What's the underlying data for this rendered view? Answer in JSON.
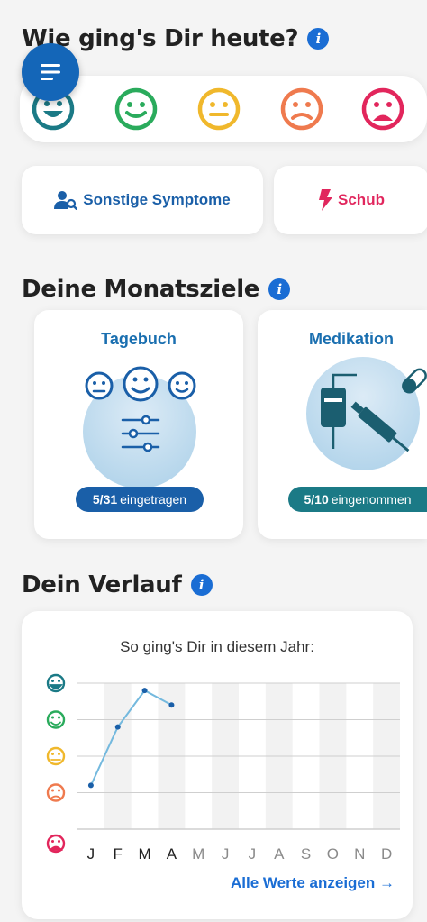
{
  "header": {
    "title": "Wie ging's Dir heute?",
    "info_icon": "info-icon"
  },
  "menu": {
    "icon": "hamburger-menu-icon"
  },
  "moods": [
    {
      "name": "very-good",
      "color": "#1b7a86"
    },
    {
      "name": "good",
      "color": "#2aab5c"
    },
    {
      "name": "neutral",
      "color": "#f0b82c"
    },
    {
      "name": "bad",
      "color": "#ef7a4e"
    },
    {
      "name": "very-bad",
      "color": "#e2265c"
    }
  ],
  "actions": {
    "symptoms": {
      "label": "Sonstige Symptome",
      "icon": "person-search-icon",
      "color": "#1a5fa8"
    },
    "relapse": {
      "label": "Schub",
      "icon": "lightning-bolt-icon",
      "color": "#e1265d"
    }
  },
  "goals": {
    "title": "Deine Monatsziele",
    "items": [
      {
        "label": "Tagebuch",
        "count": "5/31",
        "suffix": "eingetragen",
        "pill_color": "#1a5fa8"
      },
      {
        "label": "Medikation",
        "count": "5/10",
        "suffix": "eingenommen",
        "pill_color": "#1b7a86"
      }
    ]
  },
  "history": {
    "title": "Dein Verlauf",
    "subtitle": "So ging's Dir in diesem Jahr:",
    "link_label": "Alle Werte anzeigen →"
  },
  "chart_data": {
    "type": "line",
    "x": [
      "J",
      "F",
      "M",
      "A",
      "M",
      "J",
      "J",
      "A",
      "S",
      "O",
      "N",
      "D"
    ],
    "series": [
      {
        "values": [
          1.2,
          2.8,
          3.8,
          3.4,
          null,
          null,
          null,
          null,
          null,
          null,
          null,
          null
        ]
      }
    ],
    "ylim": [
      0,
      4
    ],
    "y_ticks_icons": [
      "very-bad",
      "bad",
      "neutral",
      "good",
      "very-good"
    ],
    "active_months": 4,
    "grid": true
  }
}
